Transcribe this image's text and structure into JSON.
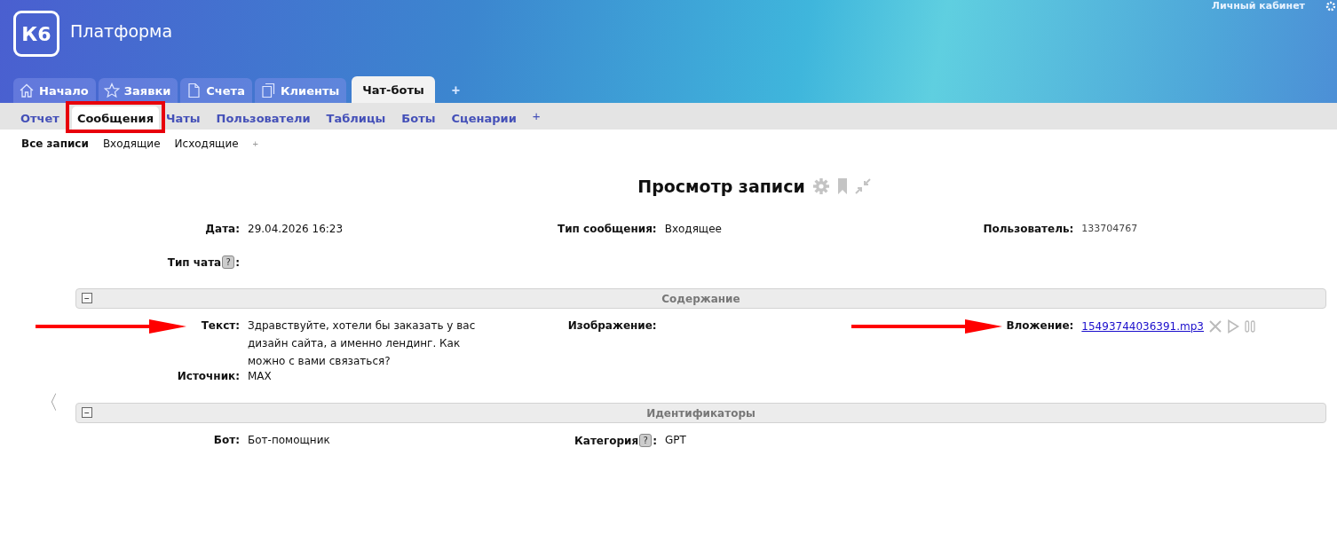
{
  "header": {
    "logo": "К6",
    "title": "Платформа",
    "account_link": "Личный кабинет"
  },
  "tabs": [
    {
      "label": "Начало",
      "selected": false
    },
    {
      "label": "Заявки",
      "selected": false
    },
    {
      "label": "Счета",
      "selected": false
    },
    {
      "label": "Клиенты",
      "selected": false
    },
    {
      "label": "Чат-боты",
      "selected": true
    }
  ],
  "tab_add": "+",
  "subtabs": [
    {
      "label": "Отчет",
      "selected": false,
      "highlighted": false
    },
    {
      "label": "Сообщения",
      "selected": true,
      "highlighted": true
    },
    {
      "label": "Чаты",
      "selected": false,
      "highlighted": false
    },
    {
      "label": "Пользователи",
      "selected": false,
      "highlighted": false
    },
    {
      "label": "Таблицы",
      "selected": false,
      "highlighted": false
    },
    {
      "label": "Боты",
      "selected": false,
      "highlighted": false
    },
    {
      "label": "Сценарии",
      "selected": false,
      "highlighted": false
    }
  ],
  "subtab_add": "+",
  "filters": [
    {
      "label": "Все записи",
      "selected": true
    },
    {
      "label": "Входящие",
      "selected": false
    },
    {
      "label": "Исходящие",
      "selected": false
    }
  ],
  "filter_add": "+",
  "back_arrow": "〈",
  "record": {
    "title": "Просмотр записи",
    "sections": [
      {
        "rows": [
          [
            {
              "label": "Дата:",
              "value": "29.04.2026 16:23",
              "kind": "text"
            },
            {
              "label": "Тип сообщения:",
              "value": "Входящее",
              "kind": "text"
            },
            {
              "label": "Пользователь:",
              "value": "133704767",
              "kind": "muted"
            }
          ],
          [
            {
              "label": "Тип чата",
              "help": "?",
              "colon": ":"
            }
          ]
        ]
      },
      {
        "heading": "Содержание",
        "collapse": "−",
        "rows": [
          [
            {
              "label": "Текст:",
              "value": "Здравствуйте, хотели бы заказать у вас дизайн сайта, а именно лендинг. Как можно с вами связаться?",
              "kind": "text",
              "arrow": true
            },
            {
              "label": "Изображение:"
            },
            {
              "label": "Вложение:",
              "value": "15493744036391.mp3",
              "kind": "file",
              "arrow": true
            }
          ],
          [
            {
              "label": "Источник:",
              "value": "MAX",
              "kind": "text"
            }
          ]
        ]
      },
      {
        "heading": "Идентификаторы",
        "collapse": "−",
        "rows": [
          [
            {
              "label": "Бот:",
              "value": "Бот-помощник",
              "kind": "text"
            },
            {
              "label": "Категория",
              "help": "?",
              "colon": ":",
              "value": "GPT",
              "kind": "text"
            }
          ]
        ]
      }
    ]
  }
}
